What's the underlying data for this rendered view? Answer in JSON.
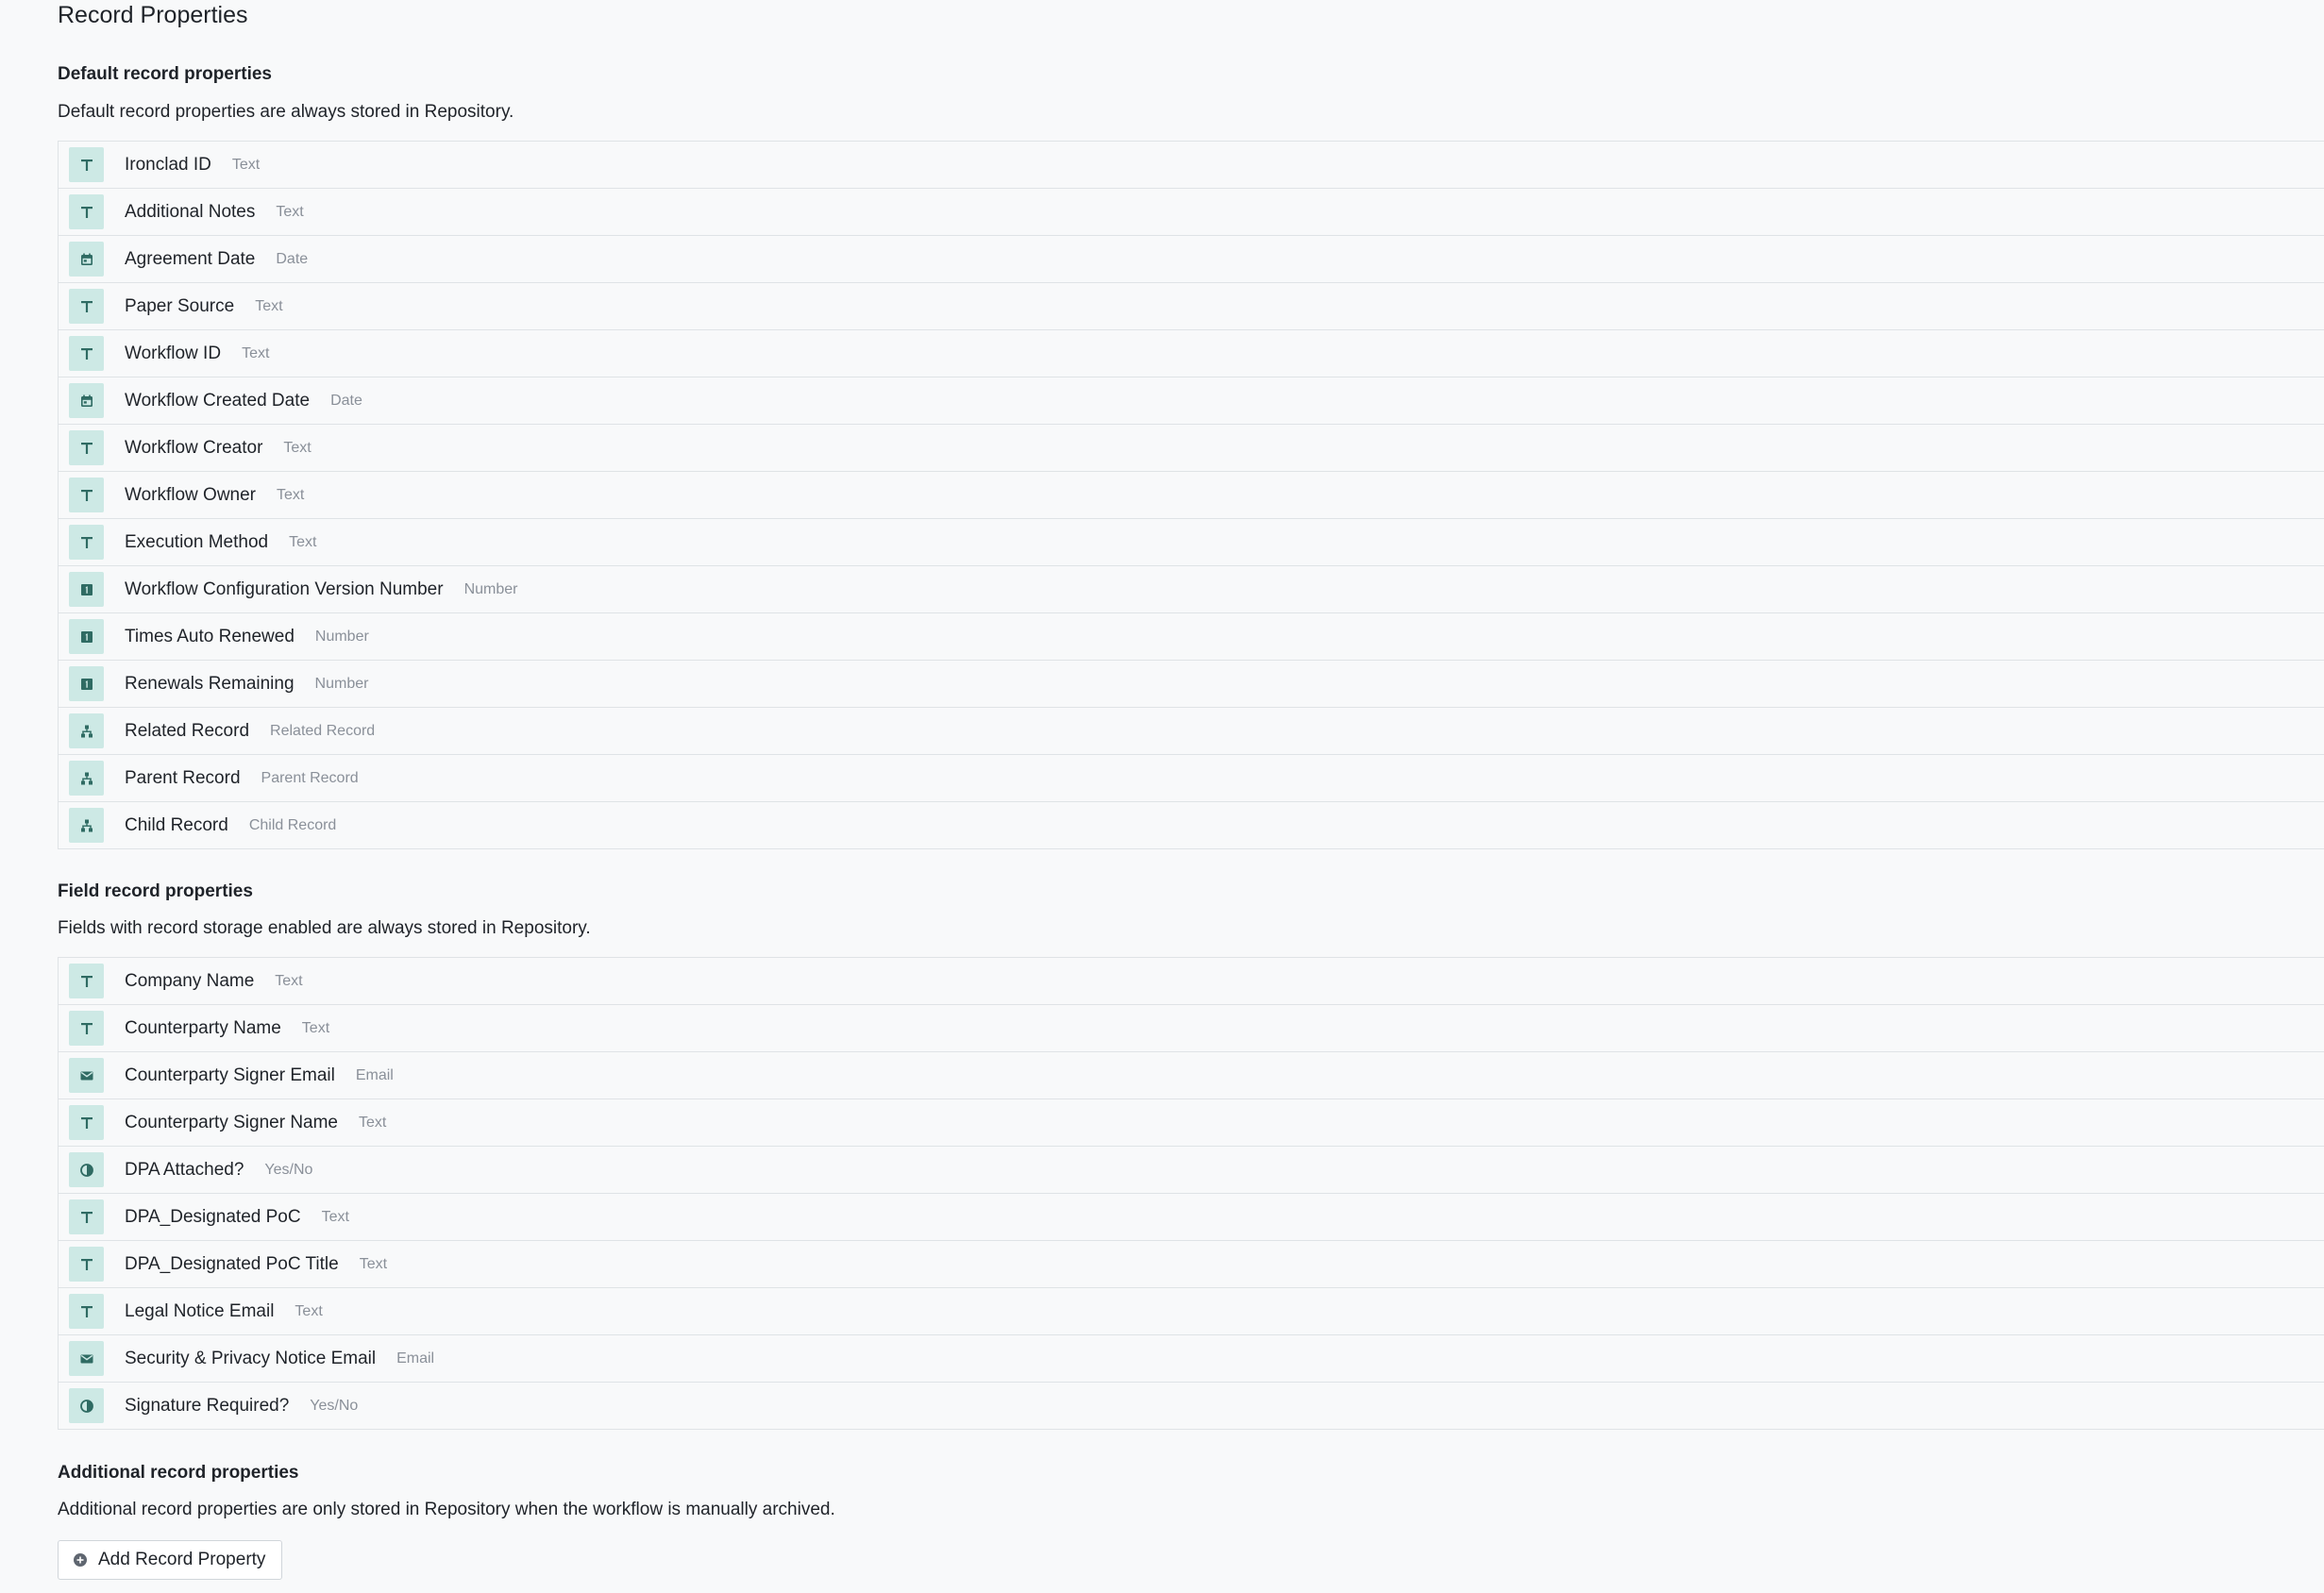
{
  "page": {
    "title": "Record Properties"
  },
  "colors": {
    "icon_bg": "#cde9e5",
    "icon_fg": "#2f6b63",
    "background": "#f8f9fa",
    "border": "#dfe3e6",
    "type_text": "#8a9099"
  },
  "default_section": {
    "heading": "Default record properties",
    "description": "Default record properties are always stored in Repository.",
    "items": [
      {
        "name": "Ironclad ID",
        "type": "Text",
        "icon": "text"
      },
      {
        "name": "Additional Notes",
        "type": "Text",
        "icon": "text"
      },
      {
        "name": "Agreement Date",
        "type": "Date",
        "icon": "date"
      },
      {
        "name": "Paper Source",
        "type": "Text",
        "icon": "text"
      },
      {
        "name": "Workflow ID",
        "type": "Text",
        "icon": "text"
      },
      {
        "name": "Workflow Created Date",
        "type": "Date",
        "icon": "date"
      },
      {
        "name": "Workflow Creator",
        "type": "Text",
        "icon": "text"
      },
      {
        "name": "Workflow Owner",
        "type": "Text",
        "icon": "text"
      },
      {
        "name": "Execution Method",
        "type": "Text",
        "icon": "text"
      },
      {
        "name": "Workflow Configuration Version Number",
        "type": "Number",
        "icon": "number"
      },
      {
        "name": "Times Auto Renewed",
        "type": "Number",
        "icon": "number"
      },
      {
        "name": "Renewals Remaining",
        "type": "Number",
        "icon": "number"
      },
      {
        "name": "Related Record",
        "type": "Related Record",
        "icon": "hierarchy"
      },
      {
        "name": "Parent Record",
        "type": "Parent Record",
        "icon": "hierarchy"
      },
      {
        "name": "Child Record",
        "type": "Child Record",
        "icon": "hierarchy"
      }
    ]
  },
  "field_section": {
    "heading": "Field record properties",
    "description": "Fields with record storage enabled are always stored in Repository.",
    "items": [
      {
        "name": "Company Name",
        "type": "Text",
        "icon": "text"
      },
      {
        "name": "Counterparty Name",
        "type": "Text",
        "icon": "text"
      },
      {
        "name": "Counterparty Signer Email",
        "type": "Email",
        "icon": "email"
      },
      {
        "name": "Counterparty Signer Name",
        "type": "Text",
        "icon": "text"
      },
      {
        "name": "DPA Attached?",
        "type": "Yes/No",
        "icon": "boolean"
      },
      {
        "name": "DPA_Designated PoC",
        "type": "Text",
        "icon": "text"
      },
      {
        "name": "DPA_Designated PoC Title",
        "type": "Text",
        "icon": "text"
      },
      {
        "name": "Legal Notice Email",
        "type": "Text",
        "icon": "text"
      },
      {
        "name": "Security & Privacy Notice Email",
        "type": "Email",
        "icon": "email"
      },
      {
        "name": "Signature Required?",
        "type": "Yes/No",
        "icon": "boolean"
      }
    ]
  },
  "additional_section": {
    "heading": "Additional record properties",
    "description": "Additional record properties are only stored in Repository when the workflow is manually archived.",
    "add_button_label": "Add Record Property",
    "add_button_icon": "plus-circle"
  }
}
